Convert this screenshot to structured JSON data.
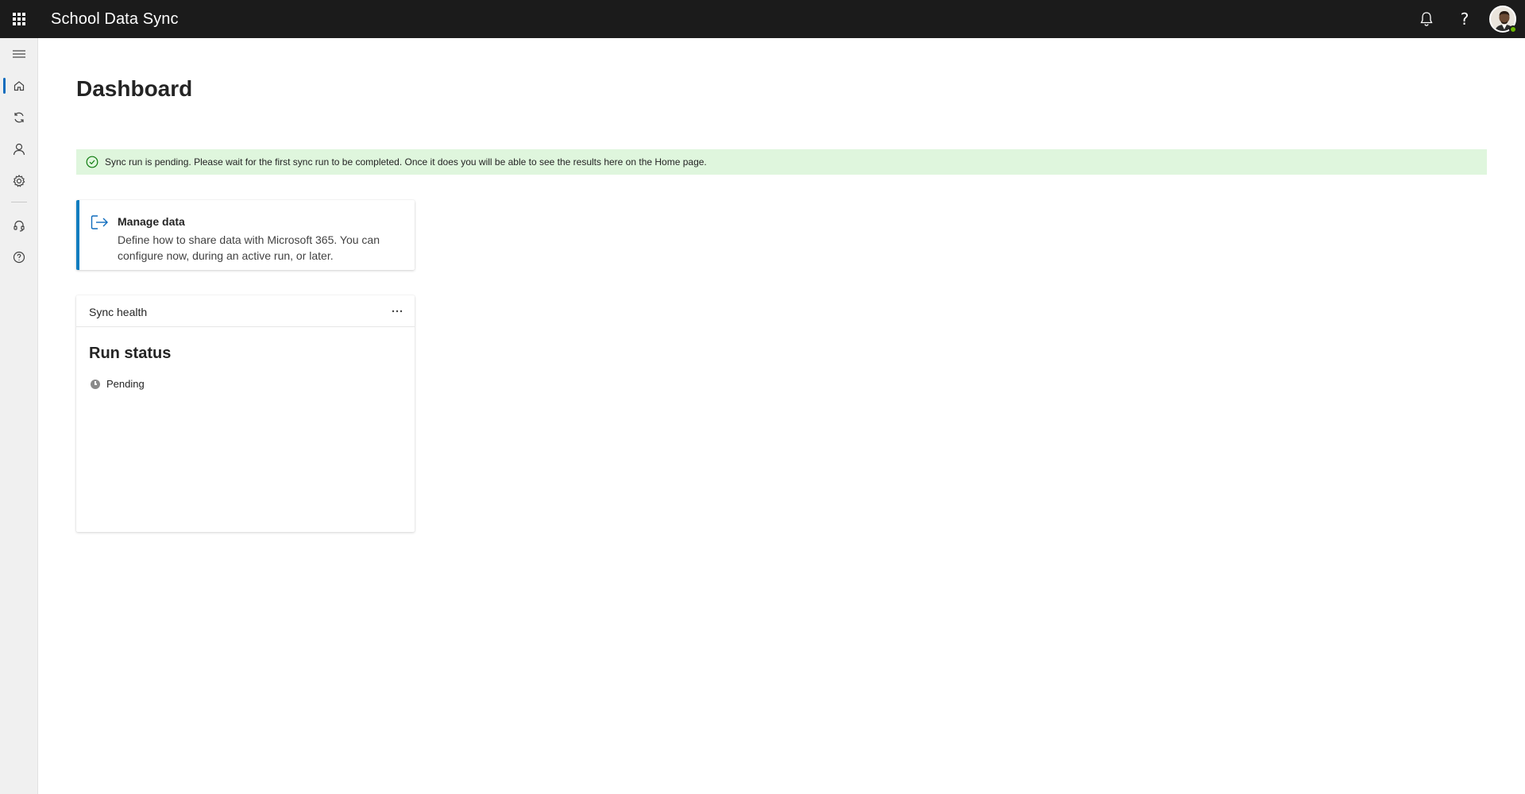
{
  "header": {
    "app_title": "School Data Sync",
    "waffle_icon": "app-launcher-icon",
    "notification_icon": "bell-icon",
    "help_label": "?",
    "avatar_icon": "user-avatar",
    "presence_color": "#6bb700"
  },
  "rail": {
    "items": [
      {
        "icon": "hamburger-icon"
      },
      {
        "icon": "home-icon",
        "active": true
      },
      {
        "icon": "sync-icon"
      },
      {
        "icon": "person-icon"
      },
      {
        "icon": "settings-icon"
      },
      {
        "icon": "headset-icon"
      },
      {
        "icon": "help-circle-icon"
      }
    ],
    "accent_color": "#0f6cbd"
  },
  "page": {
    "title": "Dashboard"
  },
  "banner": {
    "icon": "checkmark-circle-icon",
    "text": "Sync run is pending. Please wait for the first sync run to be completed. Once it does you will be able to see the results here on the Home page.",
    "background": "#dff6dd"
  },
  "manage_card": {
    "icon": "share-arrow-icon",
    "title": "Manage data",
    "description": "Define how to share data with Microsoft 365. You can configure now, during an active run, or later."
  },
  "health_card": {
    "title": "Sync health",
    "more_icon": "more-horizontal-icon",
    "run_status_title": "Run status",
    "status": {
      "icon": "clock-icon",
      "text": "Pending"
    }
  }
}
